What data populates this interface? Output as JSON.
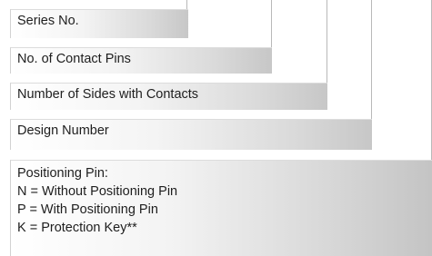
{
  "boxes": {
    "series": "Series No.",
    "pins": "No. of Contact Pins",
    "sides": "Number of Sides with Contacts",
    "design": "Design Number",
    "positioning": {
      "heading": "Positioning Pin:",
      "options": [
        "N = Without Positioning Pin",
        "P = With Positioning Pin",
        "K = Protection Key**"
      ]
    }
  }
}
